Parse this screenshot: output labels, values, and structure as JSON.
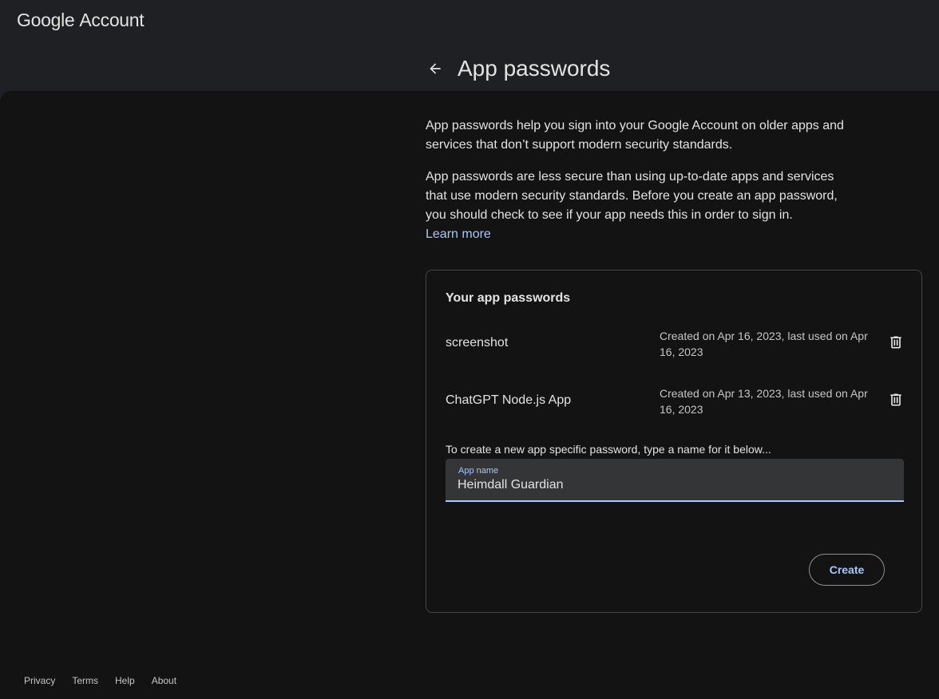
{
  "header": {
    "brand_google": "Google",
    "brand_account": "Account"
  },
  "page": {
    "title": "App passwords",
    "description_1": "App passwords help you sign into your Google Account on older apps and services that don’t support modern security standards.",
    "description_2": "App passwords are less secure than using up-to-date apps and services that use modern security standards. Before you create an app password, you should check to see if your app needs this in order to sign in.",
    "learn_more": "Learn more"
  },
  "card": {
    "title": "Your app passwords",
    "passwords": [
      {
        "name": "screenshot",
        "meta": "Created on Apr 16, 2023, last used on Apr 16, 2023"
      },
      {
        "name": "ChatGPT Node.js App",
        "meta": "Created on Apr 13, 2023, last used on Apr 16, 2023"
      }
    ],
    "hint": "To create a new app specific password, type a name for it below...",
    "field_label": "App name",
    "field_value": "Heimdall Guardian",
    "create_label": "Create"
  },
  "footer": {
    "privacy": "Privacy",
    "terms": "Terms",
    "help": "Help",
    "about": "About"
  },
  "colors": {
    "accent": "#a8c7fa",
    "background": "#131314",
    "header_background": "#1f2023"
  },
  "icons": {
    "back": "arrow-back-icon",
    "delete": "trash-icon"
  }
}
